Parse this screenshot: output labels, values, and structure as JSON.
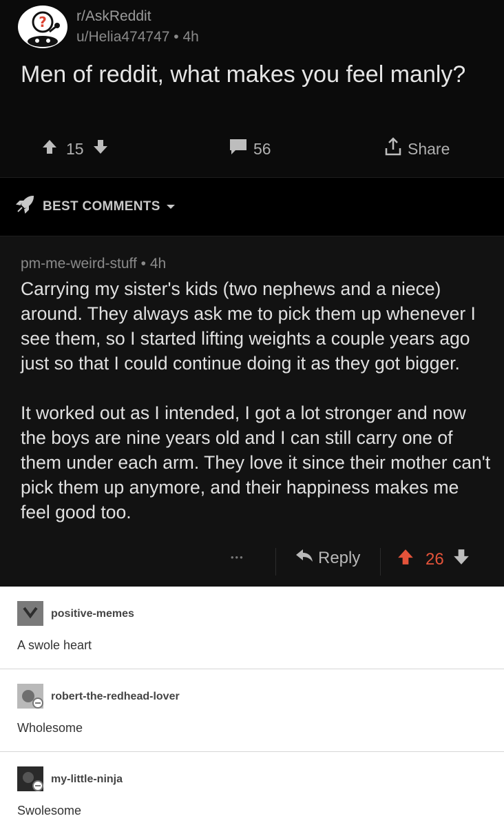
{
  "post": {
    "subreddit": "r/AskReddit",
    "author": "u/Helia474747",
    "age": "4h",
    "title": "Men of reddit, what makes you feel manly?",
    "upvotes": "15",
    "comments": "56",
    "share_label": "Share"
  },
  "sort": {
    "label": "BEST COMMENTS"
  },
  "comment": {
    "author": "pm-me-weird-stuff",
    "age": "4h",
    "paragraphs": [
      "Carrying my sister's kids (two nephews and a niece) around. They always ask me to pick them up whenever I see them, so I started lifting weights a couple years ago just so that I could continue doing it as they got bigger.",
      "It worked out as I intended, I got a lot stronger and now the boys are nine years old and I can still carry one of them under each arm. They love it since their mother can't pick them up anymore, and their happiness makes me feel good too."
    ],
    "more": "•••",
    "reply_label": "Reply",
    "score": "26"
  },
  "replies": [
    {
      "name": "positive-memes",
      "text": "A swole heart"
    },
    {
      "name": "robert-the-redhead-lover",
      "text": "Wholesome"
    },
    {
      "name": "my-little-ninja",
      "text": "Swolesome"
    }
  ],
  "colors": {
    "upvote_active": "#e4533a",
    "dark_bg": "#0b0b0b",
    "comment_bg": "#121212"
  },
  "icons": [
    "snoo-question-avatar",
    "upvote-icon",
    "downvote-icon",
    "comment-icon",
    "share-icon",
    "rocket-icon",
    "chevron-down-icon",
    "reply-icon"
  ]
}
